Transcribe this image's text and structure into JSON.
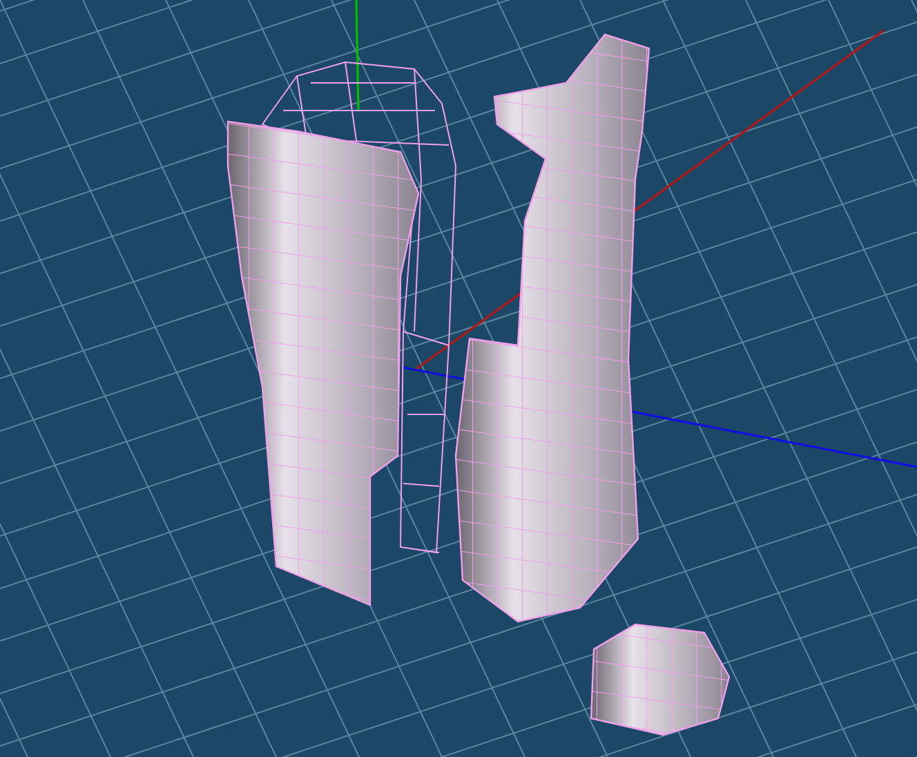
{
  "viewport": {
    "axes": [
      {
        "color": "#00c000"
      },
      {
        "color": "#b01818"
      },
      {
        "color": "#1010e0"
      }
    ]
  }
}
